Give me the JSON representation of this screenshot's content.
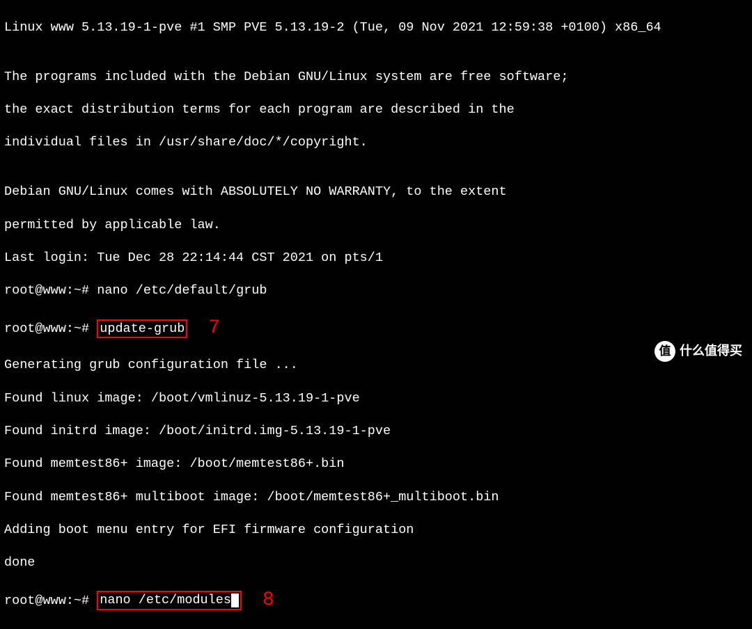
{
  "lines": {
    "uname": "Linux www 5.13.19-1-pve #1 SMP PVE 5.13.19-2 (Tue, 09 Nov 2021 12:59:38 +0100) x86_64",
    "blank1": "",
    "motd1": "The programs included with the Debian GNU/Linux system are free software;",
    "motd2": "the exact distribution terms for each program are described in the",
    "motd3": "individual files in /usr/share/doc/*/copyright.",
    "blank2": "",
    "motd4": "Debian GNU/Linux comes with ABSOLUTELY NO WARRANTY, to the extent",
    "motd5": "permitted by applicable law.",
    "lastlogin": "Last login: Tue Dec 28 22:14:44 CST 2021 on pts/1",
    "prompt1_prefix": "root@www:~# ",
    "prompt1_cmd": "nano /etc/default/grub",
    "prompt2_prefix": "root@www:~# ",
    "prompt2_cmd": "update-grub",
    "grub1": "Generating grub configuration file ...",
    "grub2": "Found linux image: /boot/vmlinuz-5.13.19-1-pve",
    "grub3": "Found initrd image: /boot/initrd.img-5.13.19-1-pve",
    "grub4": "Found memtest86+ image: /boot/memtest86+.bin",
    "grub5": "Found memtest86+ multiboot image: /boot/memtest86+_multiboot.bin",
    "grub6": "Adding boot menu entry for EFI firmware configuration",
    "grub7": "done",
    "prompt3_prefix": "root@www:~# ",
    "prompt3_cmd": "nano /etc/modules"
  },
  "annotations": {
    "a7": "7",
    "a8": "8"
  },
  "watermark": {
    "logo": "值",
    "text": "什么值得买"
  }
}
